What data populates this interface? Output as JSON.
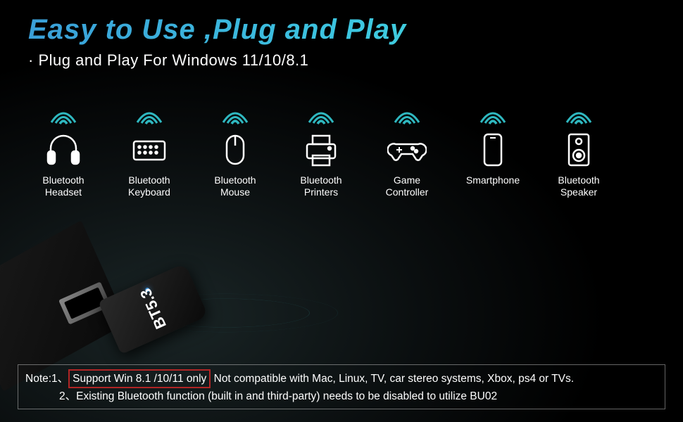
{
  "header": {
    "title": "Easy to Use ,Plug and Play",
    "subtitle": "· Plug and Play For Windows 11/10/8.1"
  },
  "devices": [
    {
      "label": "Bluetooth\nHeadset",
      "icon": "headset"
    },
    {
      "label": "Bluetooth\nKeyboard",
      "icon": "keyboard"
    },
    {
      "label": "Bluetooth\nMouse",
      "icon": "mouse"
    },
    {
      "label": "Bluetooth\nPrinters",
      "icon": "printer"
    },
    {
      "label": "Game\nController",
      "icon": "gamepad"
    },
    {
      "label": "Smartphone",
      "icon": "phone"
    },
    {
      "label": "Bluetooth\nSpeaker",
      "icon": "speaker"
    }
  ],
  "product": {
    "label": "BT5.3"
  },
  "note": {
    "prefix1": "Note:1、",
    "highlight": "Support Win 8.1 /10/11 only",
    "suffix1": " Not compatible with Mac, Linux, TV, car stereo systems, Xbox, ps4 or TVs.",
    "line2": "2、Existing  Bluetooth function (built in and third-party)  needs to be disabled to utilize BU02"
  }
}
